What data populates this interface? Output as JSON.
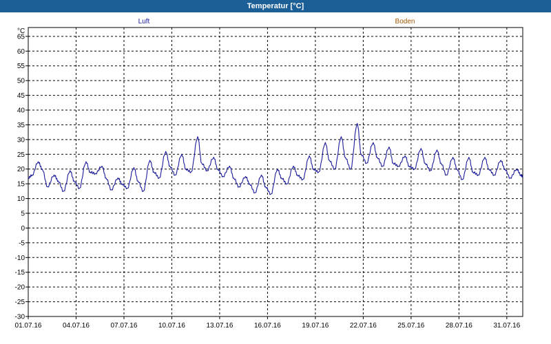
{
  "window": {
    "title": "Temperatur [°C]"
  },
  "chart_data": {
    "type": "line",
    "title": "Temperatur [°C]",
    "ylabel": "°C",
    "xlabel": "",
    "ylim": [
      -30,
      68
    ],
    "xlim": [
      "2016-07-01",
      "2016-08-01"
    ],
    "grid": true,
    "yticks": [
      65,
      60,
      55,
      50,
      45,
      40,
      35,
      30,
      25,
      20,
      15,
      10,
      5,
      0,
      -5,
      -10,
      -15,
      -20,
      -25,
      -30
    ],
    "xtick_labels": [
      "01.07.16",
      "04.07.16",
      "07.07.16",
      "10.07.16",
      "13.07.16",
      "16.07.16",
      "19.07.16",
      "22.07.16",
      "25.07.16",
      "28.07.16",
      "31.07.16"
    ],
    "xtick_dates": [
      "2016-07-01",
      "2016-07-04",
      "2016-07-07",
      "2016-07-10",
      "2016-07-13",
      "2016-07-16",
      "2016-07-19",
      "2016-07-22",
      "2016-07-25",
      "2016-07-28",
      "2016-07-31"
    ],
    "legend": [
      {
        "name": "Luft",
        "color": "#1a1a9a"
      },
      {
        "name": "Boden",
        "color": "#a05a00"
      }
    ],
    "series": [
      {
        "name": "Luft",
        "color": "#1a1a9a",
        "x": [
          "2016-07-01 00:00",
          "2016-07-01 06:00",
          "2016-07-01 15:00",
          "2016-07-01 21:00",
          "2016-07-02 05:00",
          "2016-07-02 15:00",
          "2016-07-02 21:00",
          "2016-07-03 05:00",
          "2016-07-03 15:00",
          "2016-07-03 21:00",
          "2016-07-04 05:00",
          "2016-07-04 15:00",
          "2016-07-04 21:00",
          "2016-07-05 05:00",
          "2016-07-05 15:00",
          "2016-07-05 21:00",
          "2016-07-06 05:00",
          "2016-07-06 15:00",
          "2016-07-06 21:00",
          "2016-07-07 05:00",
          "2016-07-07 15:00",
          "2016-07-07 21:00",
          "2016-07-08 05:00",
          "2016-07-08 15:00",
          "2016-07-08 21:00",
          "2016-07-09 05:00",
          "2016-07-09 15:00",
          "2016-07-09 21:00",
          "2016-07-10 05:00",
          "2016-07-10 15:00",
          "2016-07-10 21:00",
          "2016-07-11 05:00",
          "2016-07-11 15:00",
          "2016-07-11 21:00",
          "2016-07-12 05:00",
          "2016-07-12 15:00",
          "2016-07-12 21:00",
          "2016-07-13 05:00",
          "2016-07-13 15:00",
          "2016-07-13 21:00",
          "2016-07-14 05:00",
          "2016-07-14 15:00",
          "2016-07-14 21:00",
          "2016-07-15 05:00",
          "2016-07-15 15:00",
          "2016-07-15 21:00",
          "2016-07-16 05:00",
          "2016-07-16 15:00",
          "2016-07-16 21:00",
          "2016-07-17 05:00",
          "2016-07-17 15:00",
          "2016-07-17 21:00",
          "2016-07-18 05:00",
          "2016-07-18 15:00",
          "2016-07-18 21:00",
          "2016-07-19 05:00",
          "2016-07-19 15:00",
          "2016-07-19 21:00",
          "2016-07-20 05:00",
          "2016-07-20 15:00",
          "2016-07-20 21:00",
          "2016-07-21 05:00",
          "2016-07-21 15:00",
          "2016-07-21 21:00",
          "2016-07-22 05:00",
          "2016-07-22 15:00",
          "2016-07-22 21:00",
          "2016-07-23 05:00",
          "2016-07-23 15:00",
          "2016-07-23 21:00",
          "2016-07-24 05:00",
          "2016-07-24 15:00",
          "2016-07-24 21:00",
          "2016-07-25 05:00",
          "2016-07-25 15:00",
          "2016-07-25 21:00",
          "2016-07-26 05:00",
          "2016-07-26 15:00",
          "2016-07-26 21:00",
          "2016-07-27 05:00",
          "2016-07-27 15:00",
          "2016-07-27 21:00",
          "2016-07-28 05:00",
          "2016-07-28 15:00",
          "2016-07-28 21:00",
          "2016-07-29 05:00",
          "2016-07-29 15:00",
          "2016-07-29 21:00",
          "2016-07-30 05:00",
          "2016-07-30 15:00",
          "2016-07-30 21:00",
          "2016-07-31 05:00",
          "2016-07-31 15:00",
          "2016-07-31 21:00",
          "2016-08-01 00:00"
        ],
        "values": [
          17,
          18,
          22.5,
          20,
          14,
          18,
          16,
          12.5,
          19.5,
          16,
          13.5,
          22.5,
          19,
          18.5,
          21,
          17,
          13,
          17,
          15,
          13.5,
          20.5,
          16,
          12.5,
          23,
          19,
          17,
          26,
          21,
          18,
          25,
          20,
          19,
          31,
          22,
          19.5,
          24,
          20,
          17.5,
          21,
          17,
          14,
          17.5,
          15,
          12,
          18,
          14,
          11.5,
          20,
          17,
          15,
          21,
          18,
          16.5,
          24.5,
          20,
          19,
          29,
          23,
          20,
          31,
          24,
          20,
          35.5,
          25,
          22,
          29,
          24,
          21,
          27.5,
          22,
          21,
          24.5,
          21,
          20,
          27,
          22,
          19.5,
          26.5,
          22,
          18,
          24,
          20,
          16.5,
          24,
          19,
          18,
          24,
          20,
          18,
          23,
          20,
          17,
          20,
          18,
          17.5
        ]
      }
    ]
  }
}
